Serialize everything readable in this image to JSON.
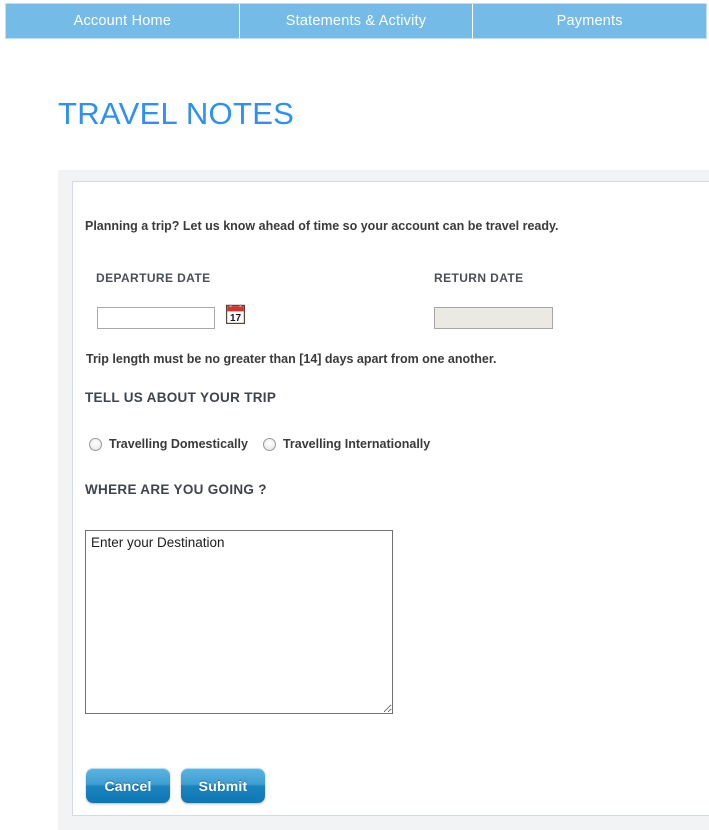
{
  "nav": {
    "tabs": [
      {
        "label": "Account Home"
      },
      {
        "label": "Statements & Activity"
      },
      {
        "label": "Payments"
      }
    ],
    "background_color": "#74bbe8"
  },
  "page": {
    "title": "TRAVEL NOTES",
    "title_color": "#2e90f4"
  },
  "form": {
    "intro": "Planning a trip? Let us know ahead of time so your account can be travel ready.",
    "departure": {
      "label": "DEPARTURE DATE",
      "value": "",
      "placeholder": "",
      "calendar_icon": "calendar-icon",
      "calendar_day": "17"
    },
    "return": {
      "label": "RETURN DATE",
      "value": "",
      "placeholder": ""
    },
    "note": "Trip length must be no greater than [14] days apart from one another.",
    "trip_section": {
      "heading": "TELL US ABOUT YOUR TRIP",
      "options": [
        {
          "label": "Travelling Domestically",
          "selected": false
        },
        {
          "label": "Travelling Internationally",
          "selected": false
        }
      ]
    },
    "destination_section": {
      "heading": "WHERE ARE YOU GOING ?",
      "value": "Enter your Destination",
      "placeholder": "Enter your Destination"
    },
    "buttons": {
      "cancel": "Cancel",
      "submit": "Submit"
    }
  }
}
